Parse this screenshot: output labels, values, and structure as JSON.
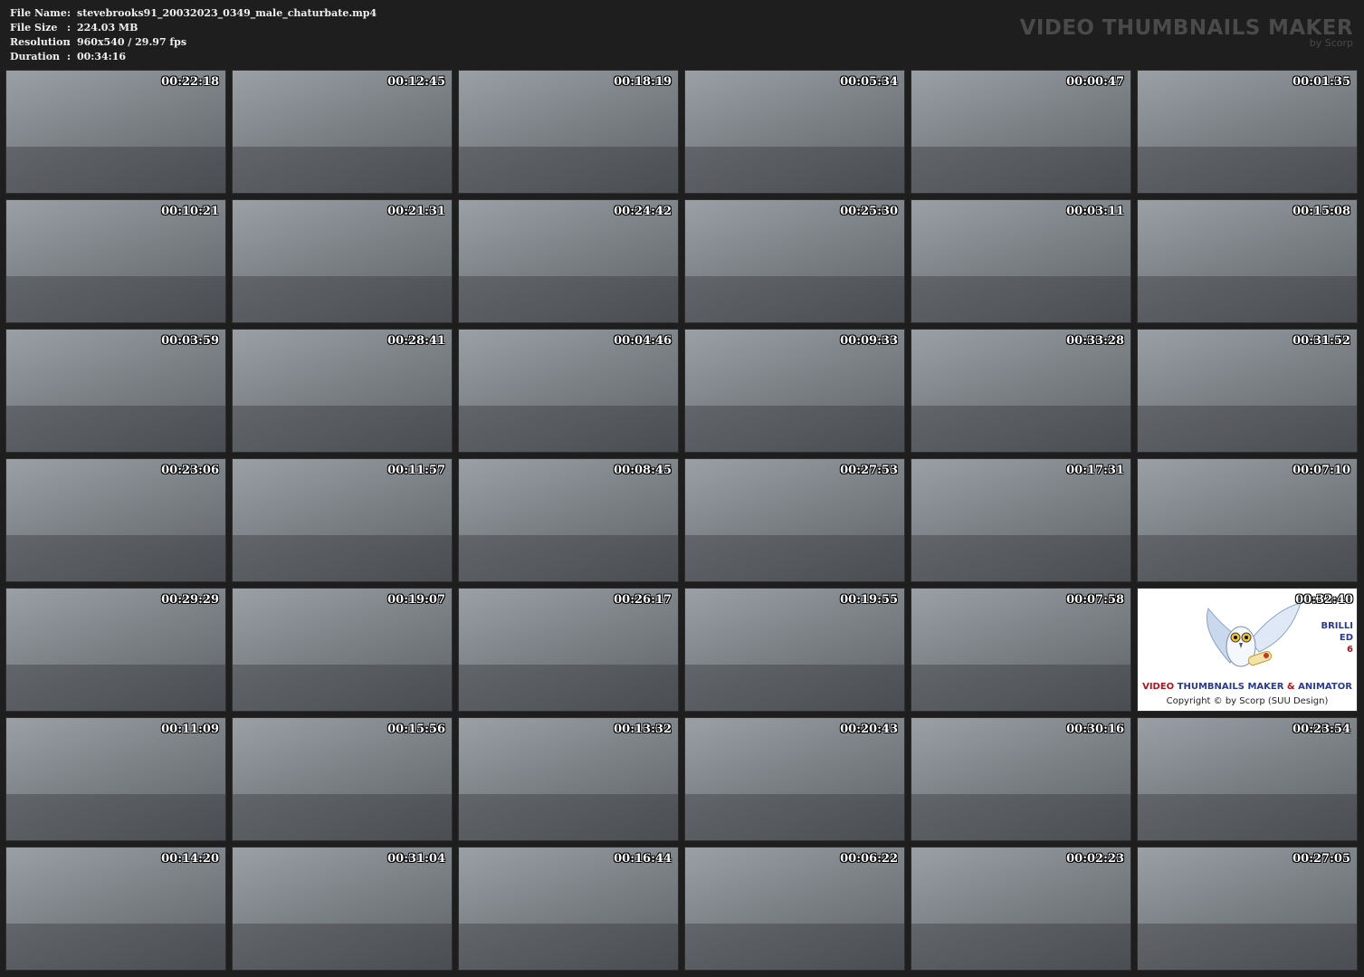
{
  "info": {
    "rows": [
      {
        "key": "File Name",
        "value": "stevebrooks91_20032023_0349_male_chaturbate.mp4"
      },
      {
        "key": "File Size",
        "value": "224.03 MB"
      },
      {
        "key": "Resolution",
        "value": "960x540 / 29.97 fps"
      },
      {
        "key": "Duration",
        "value": "00:34:16"
      }
    ],
    "separator": ":"
  },
  "brand": {
    "title": "VIDEO THUMBNAILS MAKER",
    "subtitle": "by Scorp"
  },
  "thumbnails": [
    "00:22:18",
    "00:12:45",
    "00:18:19",
    "00:05:34",
    "00:00:47",
    "00:01:35",
    "00:10:21",
    "00:21:31",
    "00:24:42",
    "00:25:30",
    "00:03:11",
    "00:15:08",
    "00:03:59",
    "00:28:41",
    "00:04:46",
    "00:09:33",
    "00:33:28",
    "00:31:52",
    "00:23:06",
    "00:11:57",
    "00:08:45",
    "00:27:53",
    "00:17:31",
    "00:07:10",
    "00:29:29",
    "00:19:07",
    "00:26:17",
    "00:19:55",
    "00:07:58",
    "00:32:40",
    "00:11:09",
    "00:15:56",
    "00:13:32",
    "00:20:43",
    "00:30:16",
    "00:23:54",
    "00:14:20",
    "00:31:04",
    "00:16:44",
    "00:06:22",
    "00:02:23",
    "00:27:05"
  ],
  "promo": {
    "index": 29,
    "line1": "BRILLI",
    "line2": "ED",
    "line3": "6",
    "title_a": "VIDEO",
    "title_b": "THUMBNAILS MAKER",
    "title_c": "&",
    "title_d": "ANIMATOR",
    "copyright": "Copyright © by Scorp (SUU Design)"
  }
}
